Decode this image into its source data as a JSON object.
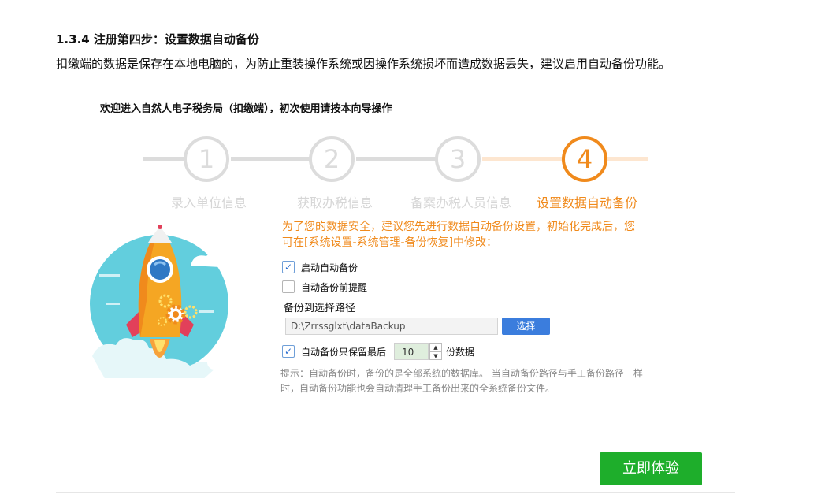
{
  "doc": {
    "heading": "1.3.4 注册第四步：设置数据自动备份",
    "intro": "扣缴端的数据是保存在本地电脑的，为防止重装操作系统或因操作系统损坏而造成数据丢失，建议启用自动备份功能。"
  },
  "wizard": {
    "title": "欢迎进入自然人电子税务局（扣缴端），初次使用请按本向导操作",
    "steps": [
      {
        "number": "1",
        "label": "录入单位信息"
      },
      {
        "number": "2",
        "label": "获取办税信息"
      },
      {
        "number": "3",
        "label": "备案办税人员信息"
      },
      {
        "number": "4",
        "label": "设置数据自动备份"
      }
    ],
    "active_step": 4
  },
  "backup": {
    "notice": "为了您的数据安全，建议您先进行数据自动备份设置，初始化完成后，您可在[系统设置-系统管理-备份恢复]中修改：",
    "enable_label": "启动自动备份",
    "enable_checked": true,
    "remind_label": "自动备份前提醒",
    "remind_checked": false,
    "path_label": "备份到选择路径",
    "path_value": "D:\\Zrrssglxt\\dataBackup",
    "choose_label": "选择",
    "keep_prefix": "自动备份只保留最后",
    "keep_checked": true,
    "keep_count": "10",
    "keep_suffix": "份数据",
    "hint": "提示：自动备份时，备份的是全部系统的数据库。 当自动备份路径与手工备份路径一样时，自动备份功能也会自动清理手工备份出来的全系统备份文件。"
  },
  "actions": {
    "try_label": "立即体验"
  },
  "colors": {
    "accent": "#f08a1c",
    "primary_button": "#3b7ddd",
    "success_button": "#1eae2b",
    "inactive": "#dcdcdc"
  },
  "icons": {
    "illustration": "rocket-illustration",
    "check": "check-icon"
  }
}
